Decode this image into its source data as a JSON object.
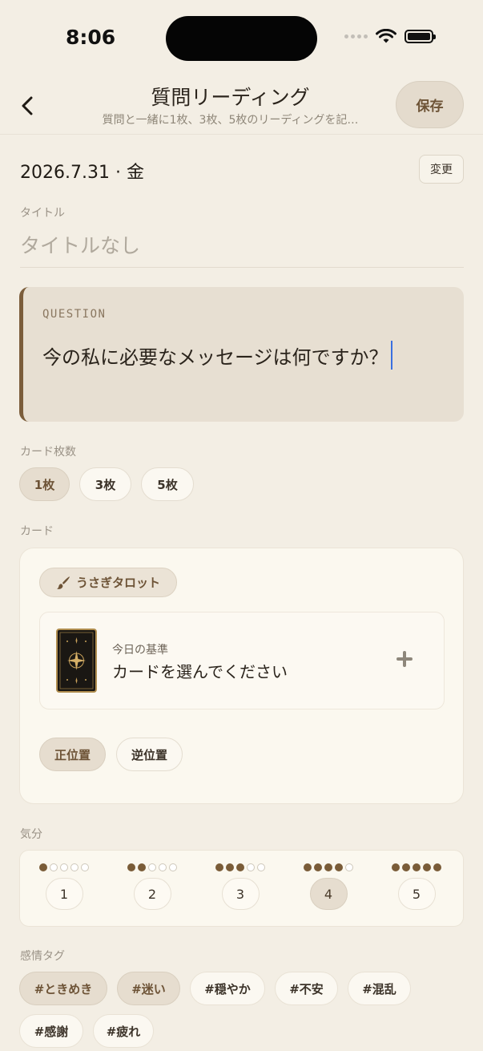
{
  "status": {
    "time": "8:06"
  },
  "header": {
    "title": "質問リーディング",
    "subtitle": "質問と一緒に1枚、3枚、5枚のリーディングを記…",
    "save_label": "保存"
  },
  "date": {
    "value": "2026.7.31 · 金",
    "change_label": "変更"
  },
  "title_field": {
    "label": "タイトル",
    "placeholder": "タイトルなし"
  },
  "question": {
    "label": "QUESTION",
    "text": "今の私に必要なメッセージは何ですか？"
  },
  "card_count": {
    "label": "カード枚数",
    "options": [
      "1枚",
      "3枚",
      "5枚"
    ],
    "selected": "1枚"
  },
  "cards": {
    "label": "カード",
    "deck_label": "うさぎタロット",
    "slot_label": "今日の基準",
    "slot_prompt": "カードを選んでください",
    "orientation_options": [
      "正位置",
      "逆位置"
    ],
    "orientation_selected": "正位置"
  },
  "mood": {
    "label": "気分",
    "options": [
      "1",
      "2",
      "3",
      "4",
      "5"
    ],
    "selected": "4"
  },
  "emotion_tags": {
    "label": "感情タグ",
    "tags": [
      "#ときめき",
      "#迷い",
      "#穏やか",
      "#不安",
      "#混乱",
      "#感謝",
      "#疲れ"
    ],
    "selected": [
      "#ときめき",
      "#迷い"
    ]
  },
  "colors": {
    "background": "#f3eee4",
    "accent": "#7b5d3b",
    "active_pill": "#e6ddcf",
    "caret": "#3a6fe0"
  },
  "icons": [
    "back-chevron-icon",
    "wifi-icon",
    "battery-icon",
    "brush-icon",
    "plus-icon"
  ]
}
